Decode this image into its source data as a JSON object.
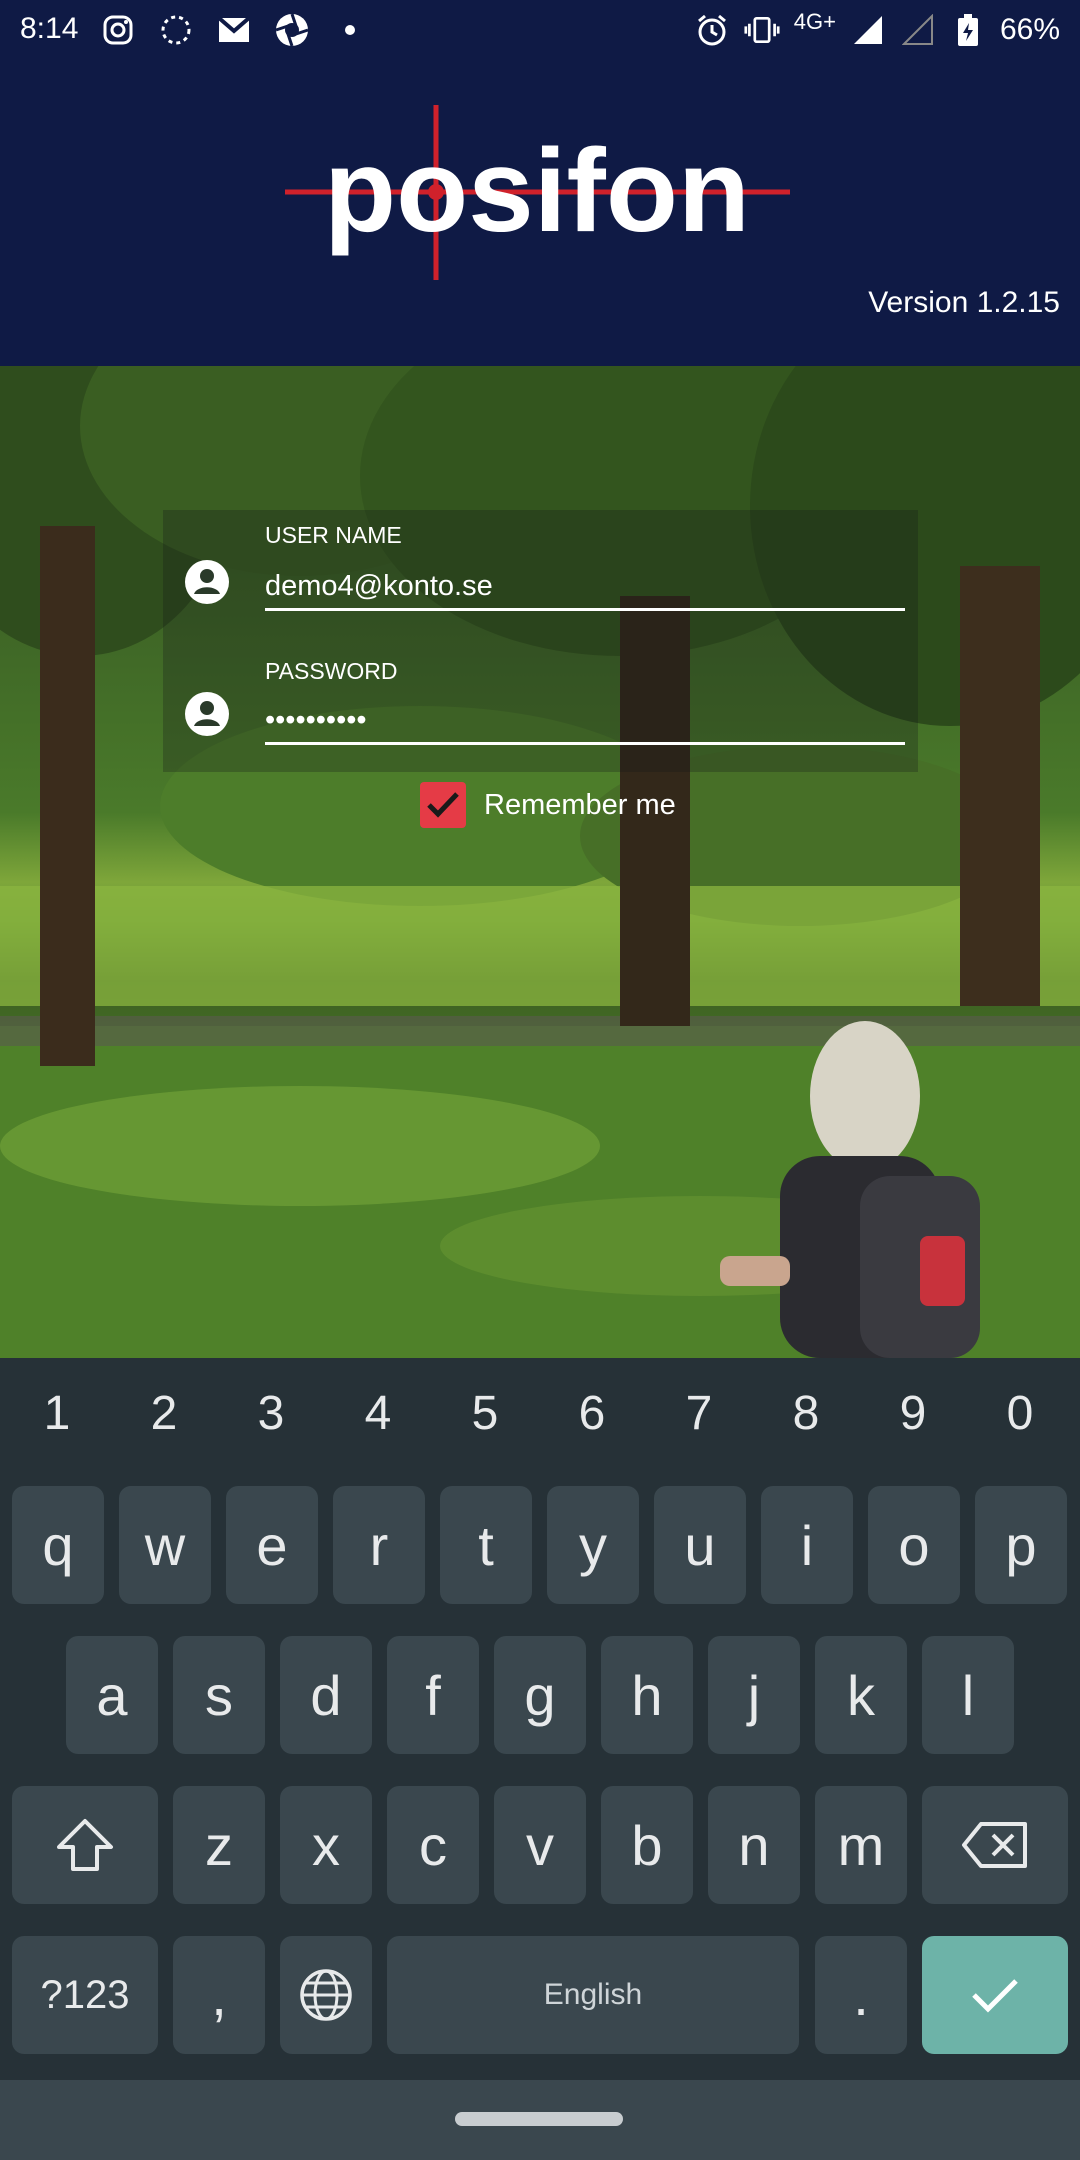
{
  "status_bar": {
    "time": "8:14",
    "network": "4G+",
    "battery": "66%"
  },
  "header": {
    "logo_text": "posifon",
    "version": "Version 1.2.15"
  },
  "form": {
    "username_label": "USER NAME",
    "username_value": "demo4@konto.se",
    "password_label": "PASSWORD",
    "password_value": "••••••••••",
    "remember_label": "Remember me",
    "remember_checked": true
  },
  "keyboard": {
    "numbers": [
      "1",
      "2",
      "3",
      "4",
      "5",
      "6",
      "7",
      "8",
      "9",
      "0"
    ],
    "row1": [
      "q",
      "w",
      "e",
      "r",
      "t",
      "y",
      "u",
      "i",
      "o",
      "p"
    ],
    "row2": [
      "a",
      "s",
      "d",
      "f",
      "g",
      "h",
      "j",
      "k",
      "l"
    ],
    "row3": [
      "z",
      "x",
      "c",
      "v",
      "b",
      "n",
      "m"
    ],
    "symbols_key": "?123",
    "comma_key": ",",
    "space_label": "English",
    "period_key": "."
  },
  "colors": {
    "header_bg": "#0f1a45",
    "accent_red": "#e53b46",
    "keyboard_bg": "#263137",
    "key_bg": "#3a474e",
    "ok_key": "#6db3a8"
  }
}
